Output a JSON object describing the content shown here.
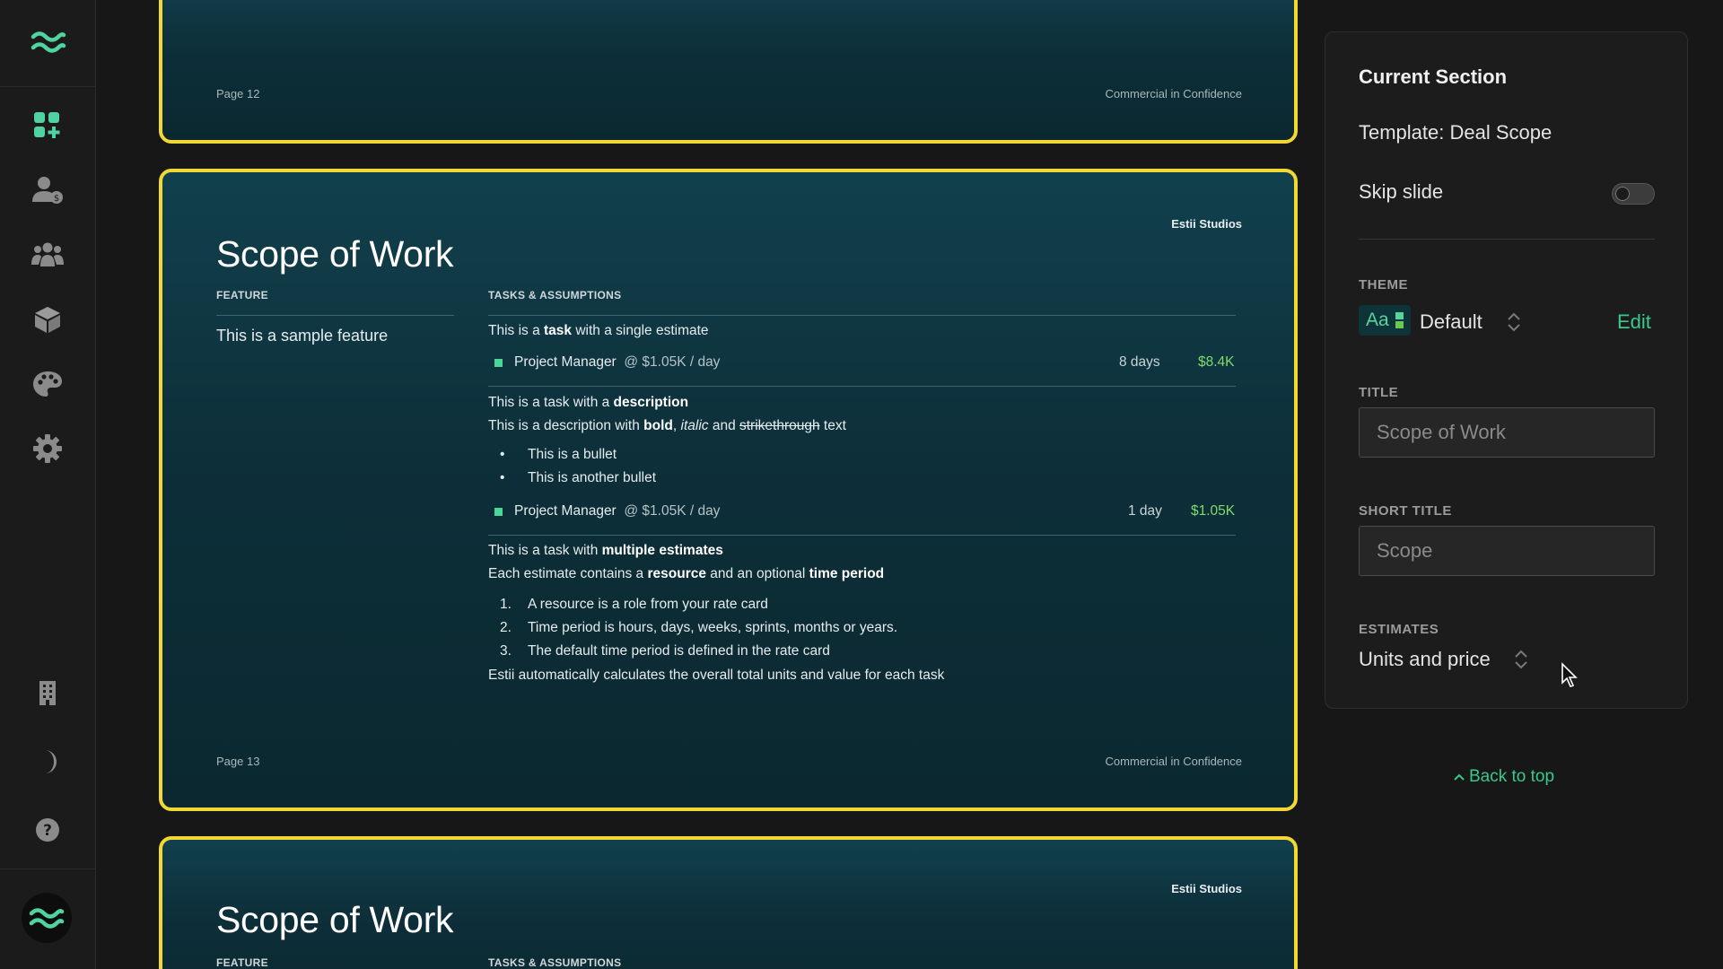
{
  "sidebar": {
    "icons": [
      "logo-icon",
      "dashboard-add-icon",
      "user-rate-icon",
      "team-icon",
      "box-icon",
      "palette-icon",
      "settings-icon",
      "building-icon",
      "dark-mode-icon",
      "help-icon",
      "avatar-icon"
    ]
  },
  "slides": {
    "prev": {
      "page": "Page 12",
      "confidential": "Commercial in Confidence"
    },
    "current": {
      "brand": "Estii Studios",
      "title": "Scope of Work",
      "feature_head": "FEATURE",
      "tasks_head": "TASKS & ASSUMPTIONS",
      "feature_text": "This is a sample feature",
      "task1": {
        "pre": "This is a ",
        "bold": "task",
        "post": " with a single estimate",
        "resource": "Project Manager",
        "rate": "@ $1.05K / day",
        "units": "8 days",
        "value": "$8.4K"
      },
      "task2": {
        "pre": "This is a task with a ",
        "bold": "description",
        "d1": "This is a description with ",
        "d_bold": "bold",
        "d2": ", ",
        "d_italic": "italic",
        "d3": " and ",
        "d_strike": "strikethrough",
        "d4": " text",
        "bullet1": "This is a bullet",
        "bullet2": "This is another bullet",
        "resource": "Project Manager",
        "rate": "@ $1.05K / day",
        "units": "1 day",
        "value": "$1.05K"
      },
      "task3": {
        "pre": "This is a task with ",
        "bold": "multiple estimates",
        "l1": "Each estimate contains a ",
        "l_b1": "resource",
        "l2": " and an optional ",
        "l_b2": "time period",
        "n1": "1.",
        "item1": "A resource is a role from your rate card",
        "n2": "2.",
        "item2": "Time period is hours, days, weeks, sprints, months or years.",
        "n3": "3.",
        "item3": "The default time period is defined in the rate card",
        "summary": "Estii automatically calculates the overall total units and value for each task"
      },
      "page": "Page 13",
      "confidential": "Commercial in Confidence"
    },
    "next": {
      "brand": "Estii Studios",
      "title": "Scope of Work",
      "feature_head": "FEATURE",
      "tasks_head": "TASKS & ASSUMPTIONS"
    }
  },
  "panel": {
    "heading": "Current Section",
    "template": "Template: Deal Scope",
    "skip_label": "Skip slide",
    "theme_label": "THEME",
    "theme_chip": "Aa",
    "theme_value": "Default",
    "edit_label": "Edit",
    "title_label": "TITLE",
    "title_placeholder": "Scope of Work",
    "short_title_label": "SHORT TITLE",
    "short_title_placeholder": "Scope",
    "estimates_label": "ESTIMATES",
    "estimates_value": "Units and price"
  },
  "back_to_top": "Back to top",
  "colors": {
    "accent": "#38c98b",
    "slide_border": "#f2d832",
    "price_green": "#7fdc6a"
  }
}
